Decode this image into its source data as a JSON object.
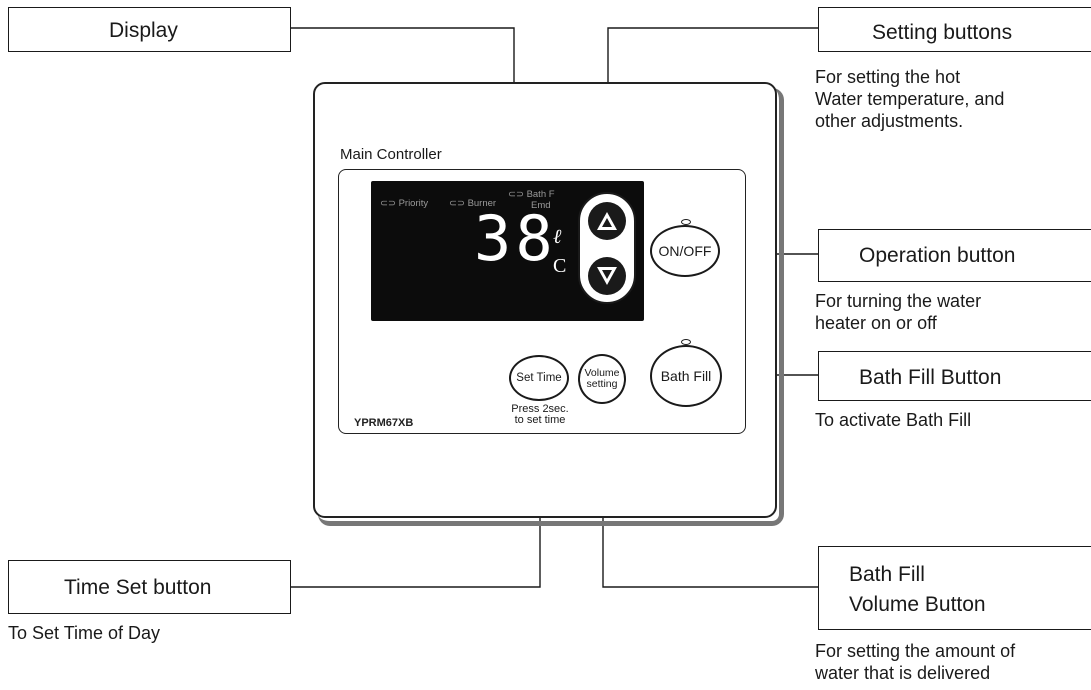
{
  "device": {
    "title": "Main Controller",
    "model": "YPRM67XB",
    "display": {
      "indicator_priority": "Priority",
      "indicator_burner": "Burner",
      "indicator_bathfill": "Bath F",
      "indicator_bathfill_line2": "Emd",
      "temperature": "38",
      "unit_top": "ℓ",
      "unit_bottom": "C"
    },
    "buttons": {
      "on_off": "ON/OFF",
      "bath_fill": "Bath Fill",
      "set_time": "Set Time",
      "volume_line1": "Volume",
      "volume_line2": "setting",
      "set_time_note_line1": "Press 2sec.",
      "set_time_note_line2": "to set time"
    }
  },
  "callouts": {
    "display": {
      "label": "Display"
    },
    "setting_buttons": {
      "label": "Setting buttons",
      "desc_line1": "For setting the hot",
      "desc_line2": "Water temperature, and",
      "desc_line3": "other adjustments."
    },
    "operation_button": {
      "label": "Operation button",
      "desc_line1": "For turning the water",
      "desc_line2": "heater on or off"
    },
    "bath_fill_button": {
      "label": "Bath Fill Button",
      "desc_line1": "To activate Bath Fill"
    },
    "time_set_button": {
      "label": "Time Set button",
      "desc_line1": "To Set Time of Day"
    },
    "volume_button": {
      "label_line1": "Bath Fill",
      "label_line2": "Volume Button",
      "desc_line1": "For setting the amount of",
      "desc_line2": "water that is delivered"
    }
  }
}
